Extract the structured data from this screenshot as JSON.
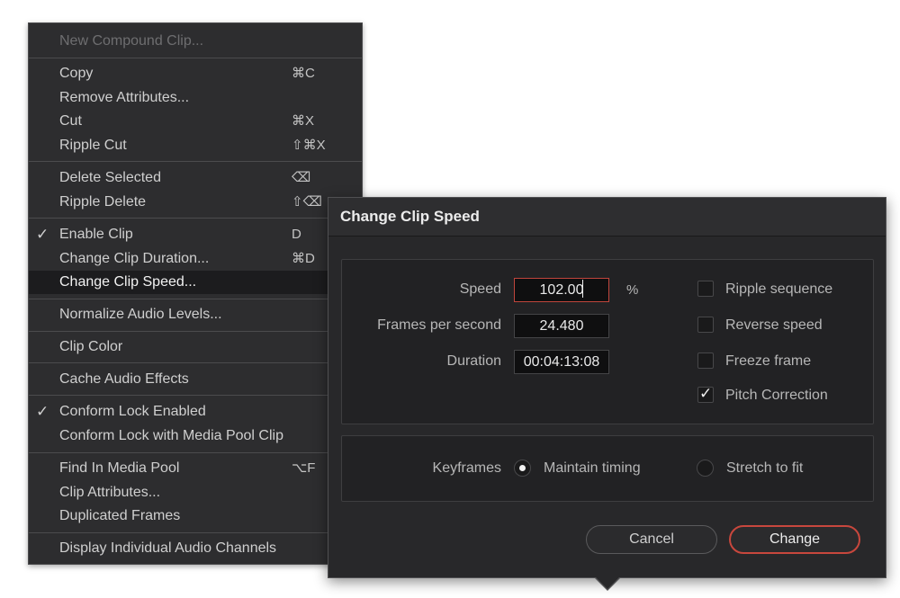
{
  "menu": {
    "items": [
      {
        "label": "New Compound Clip...",
        "shortcut": "",
        "checked": false,
        "disabled": true
      },
      {
        "label": "Copy",
        "shortcut": "⌘C",
        "checked": false
      },
      {
        "label": "Remove Attributes...",
        "shortcut": "",
        "checked": false
      },
      {
        "label": "Cut",
        "shortcut": "⌘X",
        "checked": false
      },
      {
        "label": "Ripple Cut",
        "shortcut": "⇧⌘X",
        "checked": false
      },
      {
        "label": "Delete Selected",
        "shortcut": "⌫",
        "checked": false
      },
      {
        "label": "Ripple Delete",
        "shortcut": "⇧⌫",
        "checked": false
      },
      {
        "label": "Enable Clip",
        "shortcut": "D",
        "checked": true
      },
      {
        "label": "Change Clip Duration...",
        "shortcut": "⌘D",
        "checked": false
      },
      {
        "label": "Change Clip Speed...",
        "shortcut": "",
        "checked": false,
        "highlighted": true
      },
      {
        "label": "Normalize Audio Levels...",
        "shortcut": "",
        "checked": false
      },
      {
        "label": "Clip Color",
        "shortcut": "",
        "checked": false
      },
      {
        "label": "Cache Audio Effects",
        "shortcut": "",
        "checked": false
      },
      {
        "label": "Conform Lock Enabled",
        "shortcut": "",
        "checked": true
      },
      {
        "label": "Conform Lock with Media Pool Clip",
        "shortcut": "",
        "checked": false
      },
      {
        "label": "Find In Media Pool",
        "shortcut": "⌥F",
        "checked": false
      },
      {
        "label": "Clip Attributes...",
        "shortcut": "",
        "checked": false
      },
      {
        "label": "Duplicated Frames",
        "shortcut": "",
        "checked": false
      },
      {
        "label": "Display Individual Audio Channels",
        "shortcut": "",
        "checked": false
      }
    ],
    "check_glyph": "✓"
  },
  "dialog": {
    "title": "Change Clip Speed",
    "speed_label": "Speed",
    "speed_value": "102.00",
    "speed_unit": "%",
    "fps_label": "Frames per second",
    "fps_value": "24.480",
    "duration_label": "Duration",
    "duration_value": "00:04:13:08",
    "options": [
      {
        "label": "Ripple sequence",
        "checked": false
      },
      {
        "label": "Reverse speed",
        "checked": false
      },
      {
        "label": "Freeze frame",
        "checked": false
      },
      {
        "label": "Pitch Correction",
        "checked": true
      }
    ],
    "keyframes_label": "Keyframes",
    "keyframe_modes": [
      {
        "label": "Maintain timing",
        "selected": true
      },
      {
        "label": "Stretch to fit",
        "selected": false
      }
    ],
    "cancel_label": "Cancel",
    "change_label": "Change"
  },
  "colors": {
    "menu_bg": "#2d2d2f",
    "dialog_bg": "#28282a",
    "accent_red": "#c8473d"
  }
}
